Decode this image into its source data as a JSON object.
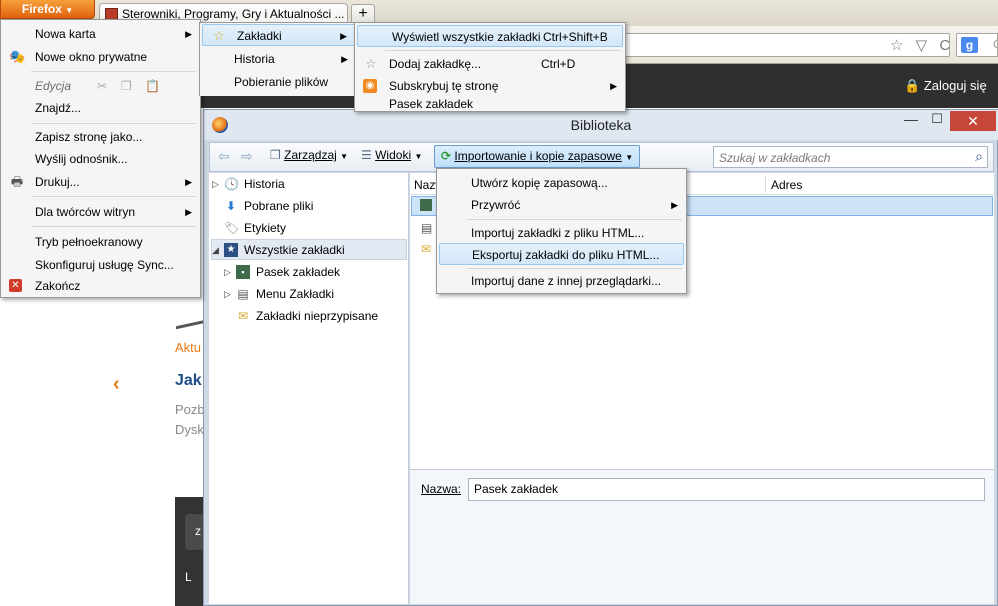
{
  "browser": {
    "firefox_button": "Firefox",
    "tab_title": "Sterowniki, Programy, Gry i Aktualności ...",
    "new_tab": "+",
    "search_engine_letter": "g",
    "search_hint": "G",
    "url_icons": "☆ ▽ C"
  },
  "site": {
    "login": "Zaloguj się",
    "orange_text": "Aktu",
    "blue_heading": "Jak",
    "gray_line1": "Pozb",
    "gray_line2": "Dysk",
    "bar_text1": "z",
    "bar_text2": "L"
  },
  "firefox_menu": {
    "items": [
      {
        "label": "Nowa karta",
        "arrow": "▶"
      },
      {
        "label": "Nowe okno prywatne"
      },
      {
        "label": "Edycja"
      },
      {
        "label": "Znajdź..."
      },
      {
        "label": "Zapisz stronę jako..."
      },
      {
        "label": "Wyślij odnośnik..."
      },
      {
        "label": "Drukuj...",
        "arrow": "▶"
      },
      {
        "label": "Dla twórców witryn",
        "arrow": "▶"
      },
      {
        "label": "Tryb pełnoekranowy"
      },
      {
        "label": "Skonfiguruj usługę Sync..."
      },
      {
        "label": "Zakończ"
      }
    ]
  },
  "right_column": {
    "items": [
      {
        "label": "Zakładki",
        "arrow": "▶"
      },
      {
        "label": "Historia",
        "arrow": "▶"
      },
      {
        "label": "Pobieranie plików"
      }
    ]
  },
  "bookmarks_menu": {
    "items": [
      {
        "label": "Wyświetl wszystkie zakładki",
        "shortcut": "Ctrl+Shift+B"
      },
      {
        "label": "Dodaj zakładkę...",
        "shortcut": "Ctrl+D"
      },
      {
        "label": "Subskrybuj tę stronę",
        "arrow": "▶"
      },
      {
        "label": "Pasek zakładek"
      }
    ]
  },
  "library": {
    "title": "Biblioteka",
    "toolbar": {
      "manage": "Zarządzaj",
      "views": "Widoki",
      "import": "Importowanie i kopie zapasowe",
      "search_placeholder": "Szukaj w zakładkach"
    },
    "tree": [
      {
        "label": "Historia"
      },
      {
        "label": "Pobrane pliki"
      },
      {
        "label": "Etykiety"
      },
      {
        "label": "Wszystkie zakładki"
      },
      {
        "label": "Pasek zakładek"
      },
      {
        "label": "Menu Zakładki"
      },
      {
        "label": "Zakładki nieprzypisane"
      }
    ],
    "columns": {
      "name_short": "Nazw",
      "address": "Adres"
    },
    "detail": {
      "name_label": "Nazwa:",
      "name_value": "Pasek zakładek"
    }
  },
  "import_menu": {
    "items": [
      {
        "label": "Utwórz kopię zapasową..."
      },
      {
        "label": "Przywróć",
        "arrow": "▶"
      },
      {
        "label": "Importuj zakładki z pliku HTML..."
      },
      {
        "label": "Eksportuj zakładki do pliku HTML..."
      },
      {
        "label": "Importuj dane z innej przeglądarki..."
      }
    ]
  },
  "window_controls": {
    "minimize": "—",
    "maximize": "☐",
    "close": "✕"
  },
  "colors": {
    "firefox_orange": "#e0620f",
    "highlight": "#d3e7f8",
    "close_red": "#c7463a"
  }
}
